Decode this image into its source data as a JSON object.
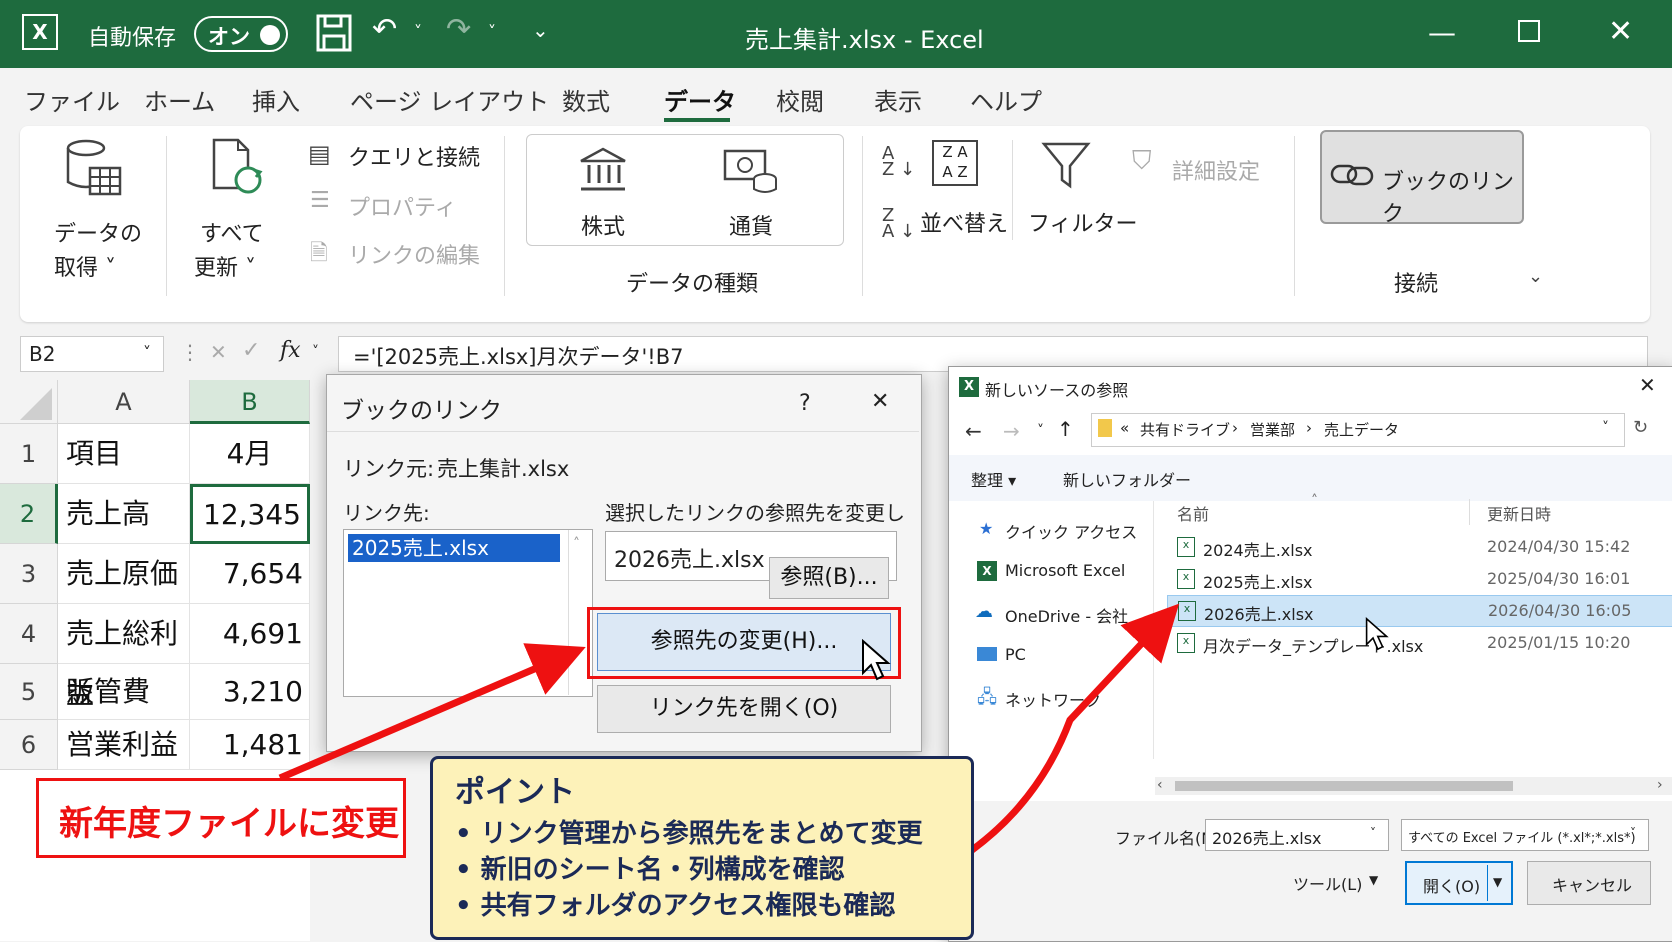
{
  "titlebar": {
    "autosave_label": "自動保存",
    "toggle_label": "オン",
    "title": "売上集計.xlsx  -  Excel",
    "bg_color": "#1e6b3e"
  },
  "menu": {
    "tabs": [
      "ファイル",
      "ホーム",
      "挿入",
      "ページ レイアウト",
      "数式",
      "データ",
      "校閲",
      "表示",
      "ヘルプ"
    ],
    "active": "データ"
  },
  "ribbon": {
    "get_data_1": "データの",
    "get_data_2": "取得 ˅",
    "refresh_1": "すべて",
    "refresh_2": "更新 ˅",
    "queries": "クエリと接続",
    "properties": "プロパティ",
    "edit_links": "リンクの編集",
    "stocks": "株式",
    "currency": "通貨",
    "data_types_group": "データの種類",
    "sort": "並べ替え",
    "filter": "フィルター",
    "advanced": "詳細設定",
    "workbook_links": "ブックのリンク",
    "connections_group": "接続"
  },
  "formula_bar": {
    "name_box": "B2",
    "fx": "fx",
    "formula": "='[2025売上.xlsx]月次データ'!B7"
  },
  "sheet": {
    "col_a": "A",
    "col_b": "B",
    "rows": [
      {
        "n": "1",
        "a": "項目",
        "b": "4月"
      },
      {
        "n": "2",
        "a": "売上高",
        "b": "12,345"
      },
      {
        "n": "3",
        "a": "売上原価",
        "b": "7,654"
      },
      {
        "n": "4",
        "a": "売上総利益",
        "b": "4,691"
      },
      {
        "n": "5",
        "a": "販管費",
        "b": "3,210"
      },
      {
        "n": "6",
        "a": "営業利益",
        "b": "1,481"
      }
    ]
  },
  "links_dialog": {
    "title": "ブックのリンク",
    "help": "?",
    "close": "✕",
    "source_label": "リンク元:",
    "source_value": "売上集計.xlsx",
    "target_label": "リンク先:",
    "target_selected": "2025売上.xlsx",
    "change_label": "選択したリンクの参照先を変更します:",
    "change_value": "2026売上.xlsx",
    "browse_btn": "参照(B)...",
    "change_btn": "参照先の変更(H)...",
    "open_btn": "リンク先を開く(O)"
  },
  "browse_dialog": {
    "title": "新しいソースの参照",
    "breadcrumb": [
      "«",
      "共有ドライブ",
      "営業部",
      "売上データ"
    ],
    "organize": "整理 ▾",
    "new_folder": "新しいフォルダー",
    "nav": [
      "クイック アクセス",
      "Microsoft Excel",
      "OneDrive - 会社",
      "PC",
      "ネットワーク"
    ],
    "col_name": "名前",
    "col_date": "更新日時",
    "files": [
      {
        "name": "2024売上.xlsx",
        "date": "2024/04/30 15:42"
      },
      {
        "name": "2025売上.xlsx",
        "date": "2025/04/30 16:01"
      },
      {
        "name": "2026売上.xlsx",
        "date": "2026/04/30 16:05"
      },
      {
        "name": "月次データ_テンプレート.xlsx",
        "date": "2025/01/15 10:20"
      }
    ],
    "filename_label": "ファイル名(N):",
    "filename_value": "2026売上.xlsx",
    "filter_value": "すべての Excel ファイル (*.xl*;*.xls*)",
    "tools": "ツール(L)",
    "open": "開く(O)",
    "cancel": "キャンセル"
  },
  "annotations": {
    "red_note": "新年度ファイルに変更",
    "point_title": "ポイント",
    "points": [
      "• リンク管理から参照先をまとめて変更",
      "• 新旧のシート名・列構成を確認",
      "• 共有フォルダのアクセス権限も確認"
    ],
    "accent_red": "#e11111",
    "note_bg": "#fdf2b9"
  }
}
